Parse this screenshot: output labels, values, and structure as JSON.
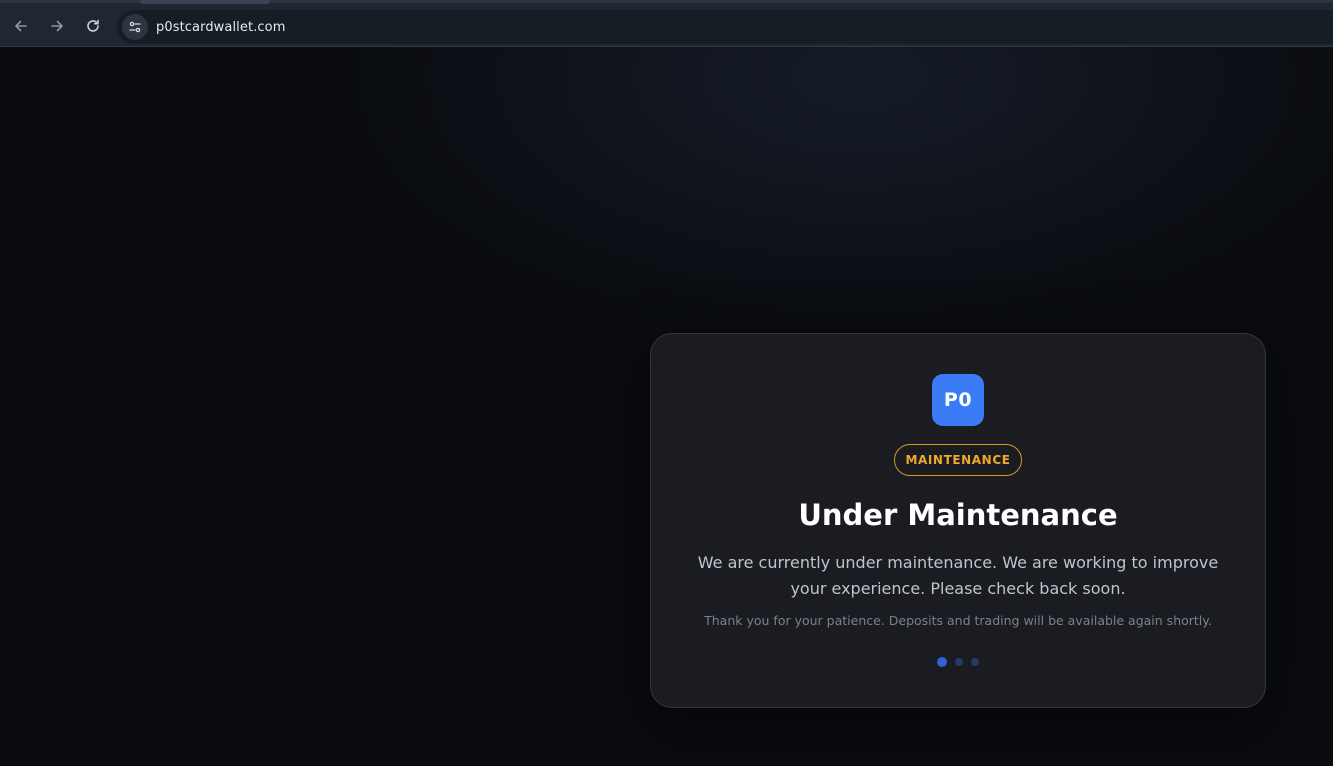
{
  "browser": {
    "url": "p0stcardwallet.com",
    "back_icon": "arrow-left-icon",
    "forward_icon": "arrow-right-icon",
    "reload_icon": "reload-icon",
    "site_info_icon": "tune-icon"
  },
  "card": {
    "logo_text": "P0",
    "logo_color": "#3b7cf6",
    "badge_text": "MAINTENANCE",
    "badge_color": "#f0a92a",
    "title": "Under Maintenance",
    "message": "We are currently under maintenance. We are working to improve your experience. Please check back soon.",
    "note": "Thank you for your patience. Deposits and trading will be available again shortly.",
    "progress_dots": {
      "count": 3,
      "active_index": 0
    }
  }
}
